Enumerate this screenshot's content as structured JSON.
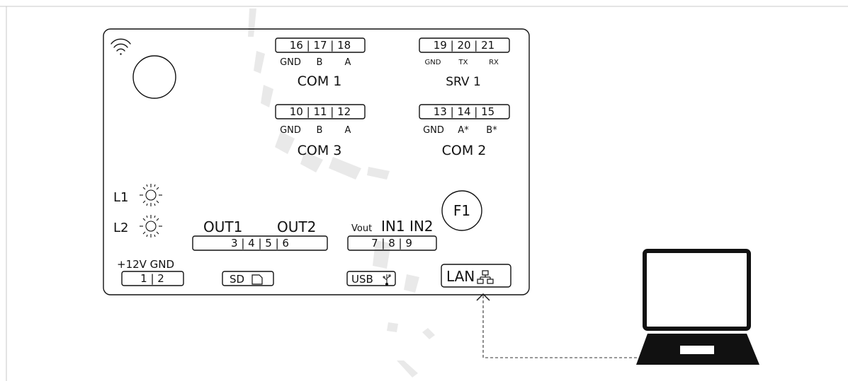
{
  "terminals": {
    "com1": {
      "pins": "16 | 17 | 18",
      "signals": [
        "GND",
        "B",
        "A"
      ],
      "title": "COM 1"
    },
    "srv1": {
      "pins": "19 | 20 | 21",
      "signals": [
        "GND",
        "TX",
        "RX"
      ],
      "title": "SRV 1"
    },
    "com3": {
      "pins": "10 | 11 | 12",
      "signals": [
        "GND",
        "B",
        "A"
      ],
      "title": "COM 3"
    },
    "com2": {
      "pins": "13 | 14 | 15",
      "signals": [
        "GND",
        "A*",
        "B*"
      ],
      "title": "COM 2"
    },
    "power": {
      "pins": "1 | 2",
      "label": "+12V GND"
    },
    "outputs": {
      "pins": "3 | 4 | 5 | 6",
      "label1": "OUT1",
      "label2": "OUT2"
    },
    "inputs": {
      "pins": "7 | 8 | 9",
      "vout": "Vout",
      "label": "IN1 IN2"
    }
  },
  "leds": {
    "l1": "L1",
    "l2": "L2"
  },
  "fuse": "F1",
  "ports": {
    "sd": "SD",
    "usb": "USB",
    "lan": "LAN"
  },
  "icons": [
    "wifi-icon",
    "sd-card-icon",
    "usb-icon",
    "network-icon",
    "laptop-icon",
    "led-icon"
  ],
  "colors": {
    "line": "#111111",
    "connection": "#333333",
    "watermark": "#e9e9e9"
  }
}
